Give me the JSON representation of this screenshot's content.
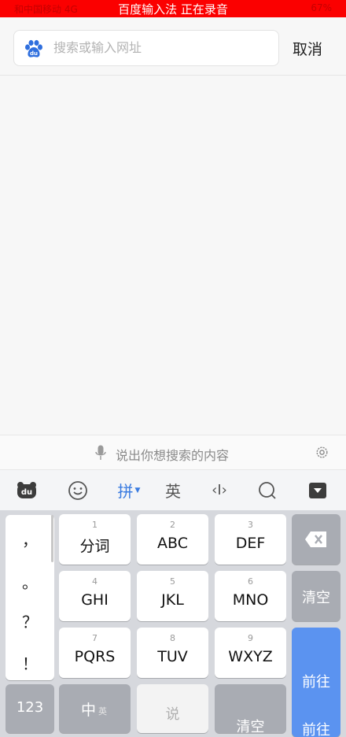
{
  "status_bar": {
    "left": "和中国移动 4G",
    "center": "百度输入法 正在录音",
    "right": "67%"
  },
  "header": {
    "search_placeholder": "搜索或输入网址",
    "cancel_label": "取消"
  },
  "voice_bar": {
    "hint": "说出你想搜索的内容"
  },
  "toolbar": {
    "pinyin_label": "拼",
    "english_label": "英",
    "cursor_label": "‹I›"
  },
  "keyboard": {
    "punctuation": [
      "，",
      "。",
      "？",
      "！"
    ],
    "keys": [
      {
        "num": "1",
        "label": "分词"
      },
      {
        "num": "2",
        "label": "ABC"
      },
      {
        "num": "3",
        "label": "DEF"
      },
      {
        "num": "4",
        "label": "GHI"
      },
      {
        "num": "5",
        "label": "JKL"
      },
      {
        "num": "6",
        "label": "MNO"
      },
      {
        "num": "7",
        "label": "PQRS"
      },
      {
        "num": "8",
        "label": "TUV"
      },
      {
        "num": "9",
        "label": "WXYZ"
      }
    ],
    "clear_label": "清空",
    "go_label": "前往",
    "num_label": "123",
    "cn_label": "中",
    "en_small_label": "英",
    "space_label": "说",
    "bottom_clear_label": "清空",
    "bottom_go_label": "前往"
  },
  "colors": {
    "status_bar": "#fb0000",
    "accent": "#3a7be0",
    "go_key": "#5b93f0"
  }
}
